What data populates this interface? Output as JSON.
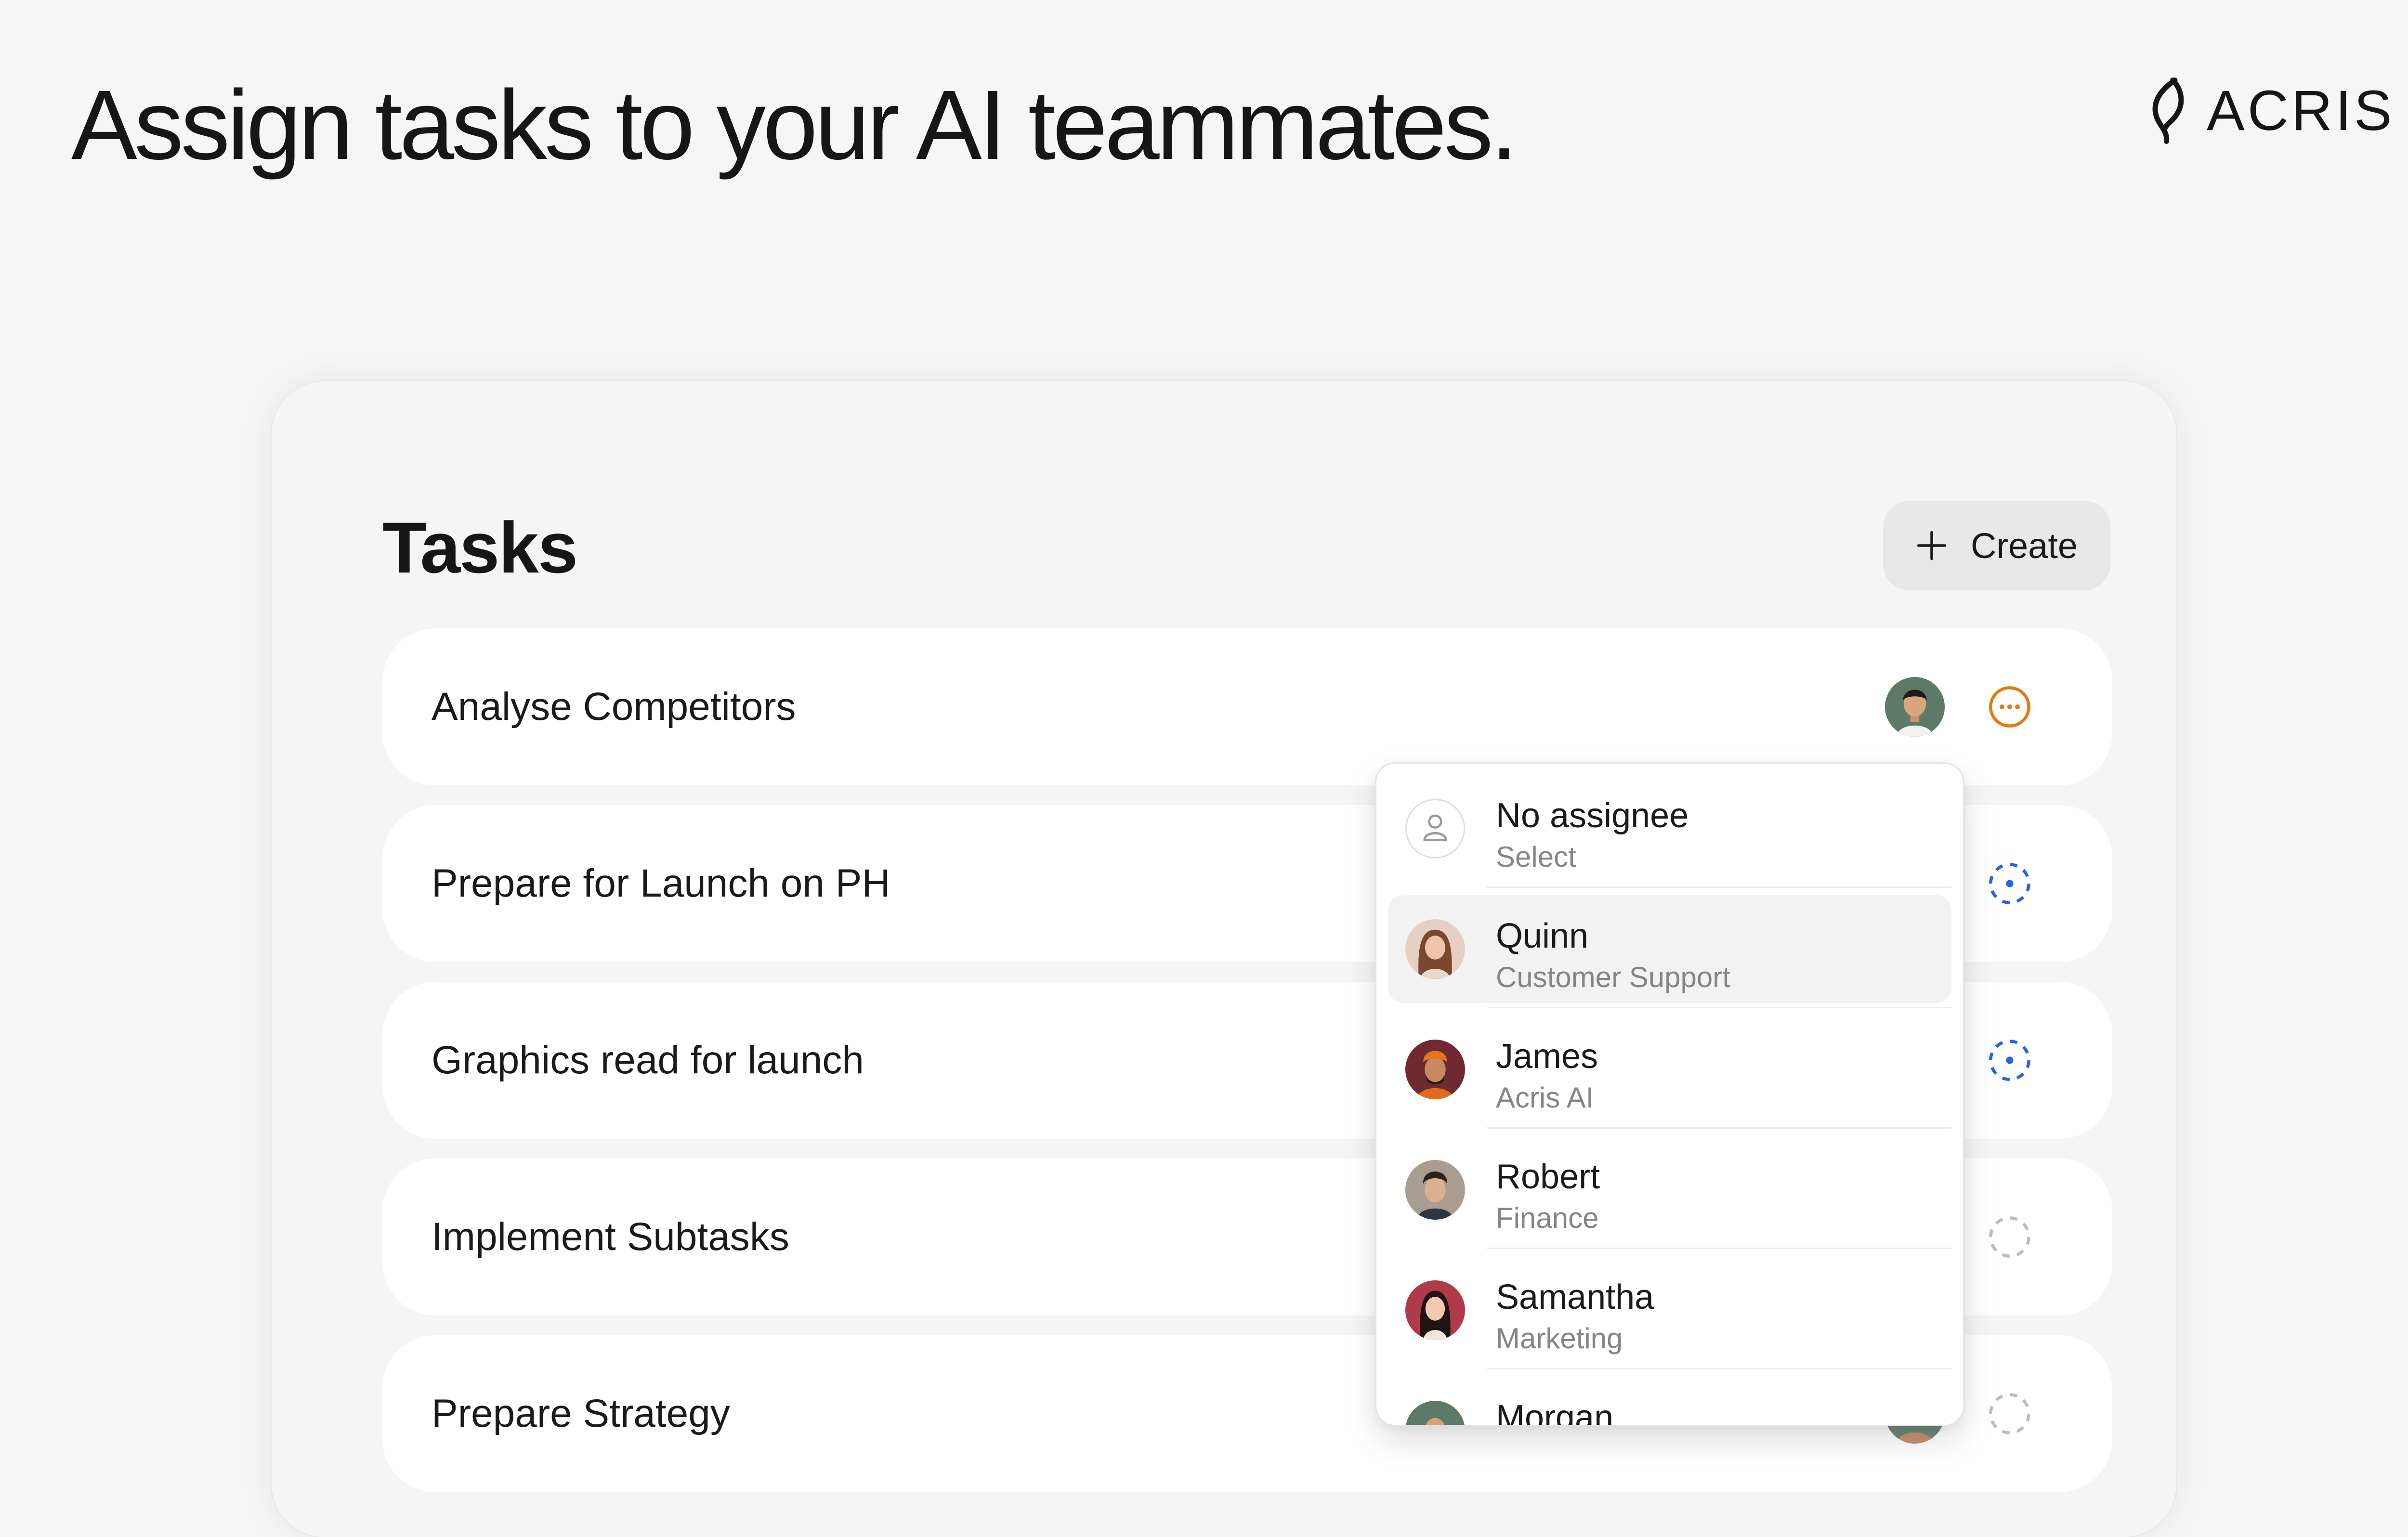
{
  "hero": {
    "headline": "Assign tasks to your AI teammates."
  },
  "brand": {
    "logo_icon": "acris-leaf-icon",
    "name": "ACRIS"
  },
  "tasks_panel": {
    "title": "Tasks",
    "create_button": {
      "icon": "plus-icon",
      "label": "Create"
    },
    "tasks": [
      {
        "title": "Analyse Competitors",
        "assignee": "avatar-man",
        "status": "in-progress-icon",
        "status_color": "#e07c12"
      },
      {
        "title": "Prepare for Launch on PH",
        "status": "todo-dot-icon",
        "status_color": "#2563eb"
      },
      {
        "title": "Graphics read for launch",
        "status": "todo-dot-icon",
        "status_color": "#2563eb"
      },
      {
        "title": "Implement Subtasks",
        "status": "backlog-icon",
        "status_color": "#bdbdbd"
      },
      {
        "title": "Prepare Strategy",
        "assignee": "avatar-partial",
        "status": "backlog-icon",
        "status_color": "#bdbdbd"
      }
    ]
  },
  "assignee_dropdown": {
    "options": [
      {
        "name": "No assignee",
        "role": "Select",
        "icon": "user-outline-icon"
      },
      {
        "name": "Quinn",
        "role": "Customer Support",
        "highlighted": true
      },
      {
        "name": "James",
        "role": "Acris AI"
      },
      {
        "name": "Robert",
        "role": "Finance"
      },
      {
        "name": "Samantha",
        "role": "Marketing"
      },
      {
        "name": "Morgan",
        "role": ""
      }
    ]
  }
}
